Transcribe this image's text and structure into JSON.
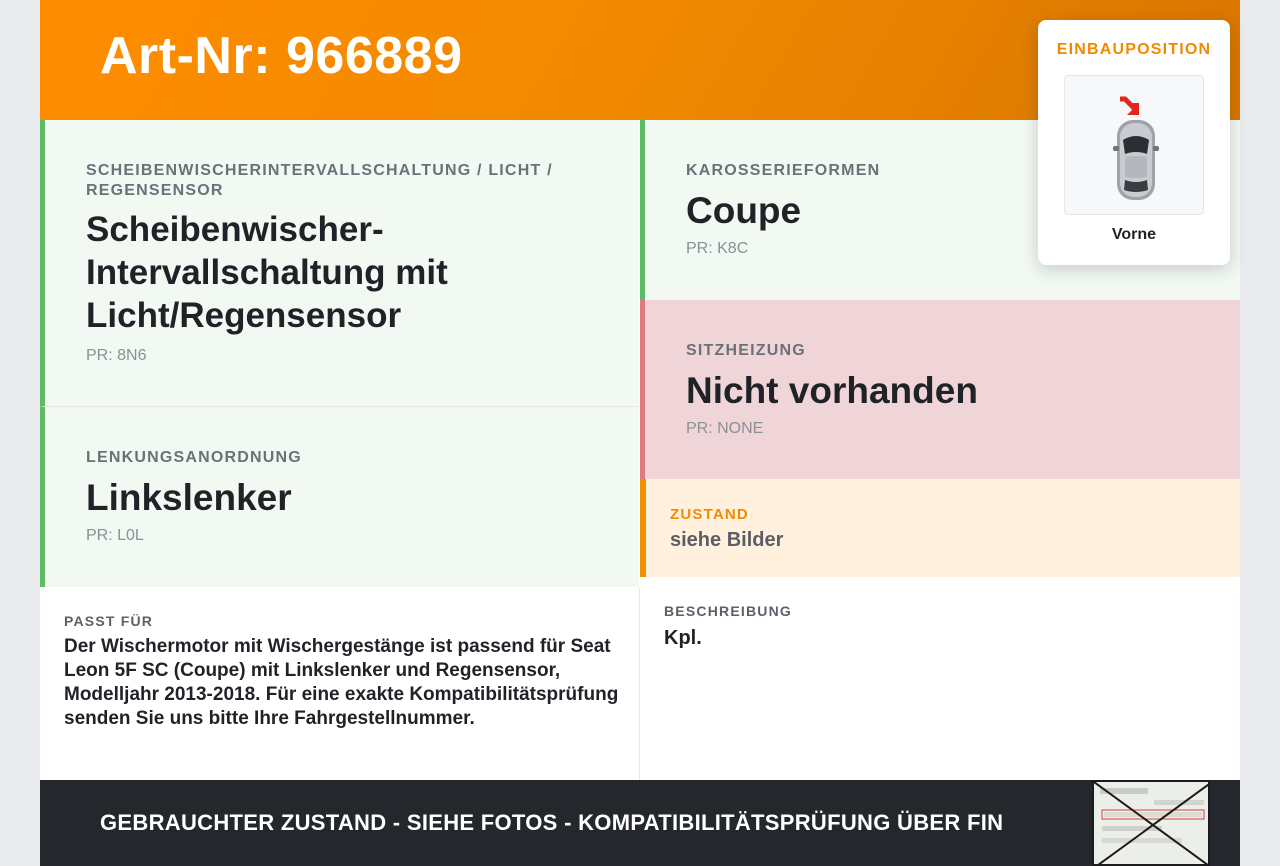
{
  "header": {
    "art_nr": "Art-Nr: 966889"
  },
  "einbau": {
    "title": "EINBAUPOSITION",
    "position": "Vorne"
  },
  "cells": {
    "scheibe": {
      "label": "SCHEIBENWISCHERINTERVALLSCHALTUNG / LICHT / REGENSENSOR",
      "value": "Scheibenwischer-Intervallschaltung mit Licht/Regensensor",
      "pr": "PR: 8N6"
    },
    "lenkung": {
      "label": "LENKUNGSANORDNUNG",
      "value": "Linkslenker",
      "pr": "PR: L0L"
    },
    "karosserie": {
      "label": "KAROSSERIEFORMEN",
      "value": "Coupe",
      "pr": "PR: K8C"
    },
    "sitzheizung": {
      "label": "SITZHEIZUNG",
      "value": "Nicht vorhanden",
      "pr": "PR: NONE"
    },
    "zustand": {
      "label": "ZUSTAND",
      "value": "siehe Bilder"
    },
    "passt": {
      "label": "PASST FÜR",
      "text": "Der Wischermotor mit Wischergestänge ist passend für Seat Leon 5F SC (Coupe) mit Linkslenker und Regensensor, Modelljahr 2013-2018. Für eine exakte Kompatibilitätsprüfung senden Sie uns bitte Ihre Fahrgestellnummer."
    },
    "beschreibung": {
      "label": "BESCHREIBUNG",
      "value": "Kpl."
    }
  },
  "footer": {
    "text": "GEBRAUCHTER ZUSTAND - SIEHE FOTOS - KOMPATIBILITÄTSPRÜFUNG ÜBER FIN"
  },
  "colors": {
    "accent": "#f28a00",
    "green": "#5dbb63",
    "red": "#e07a80",
    "dark": "#24272b"
  }
}
